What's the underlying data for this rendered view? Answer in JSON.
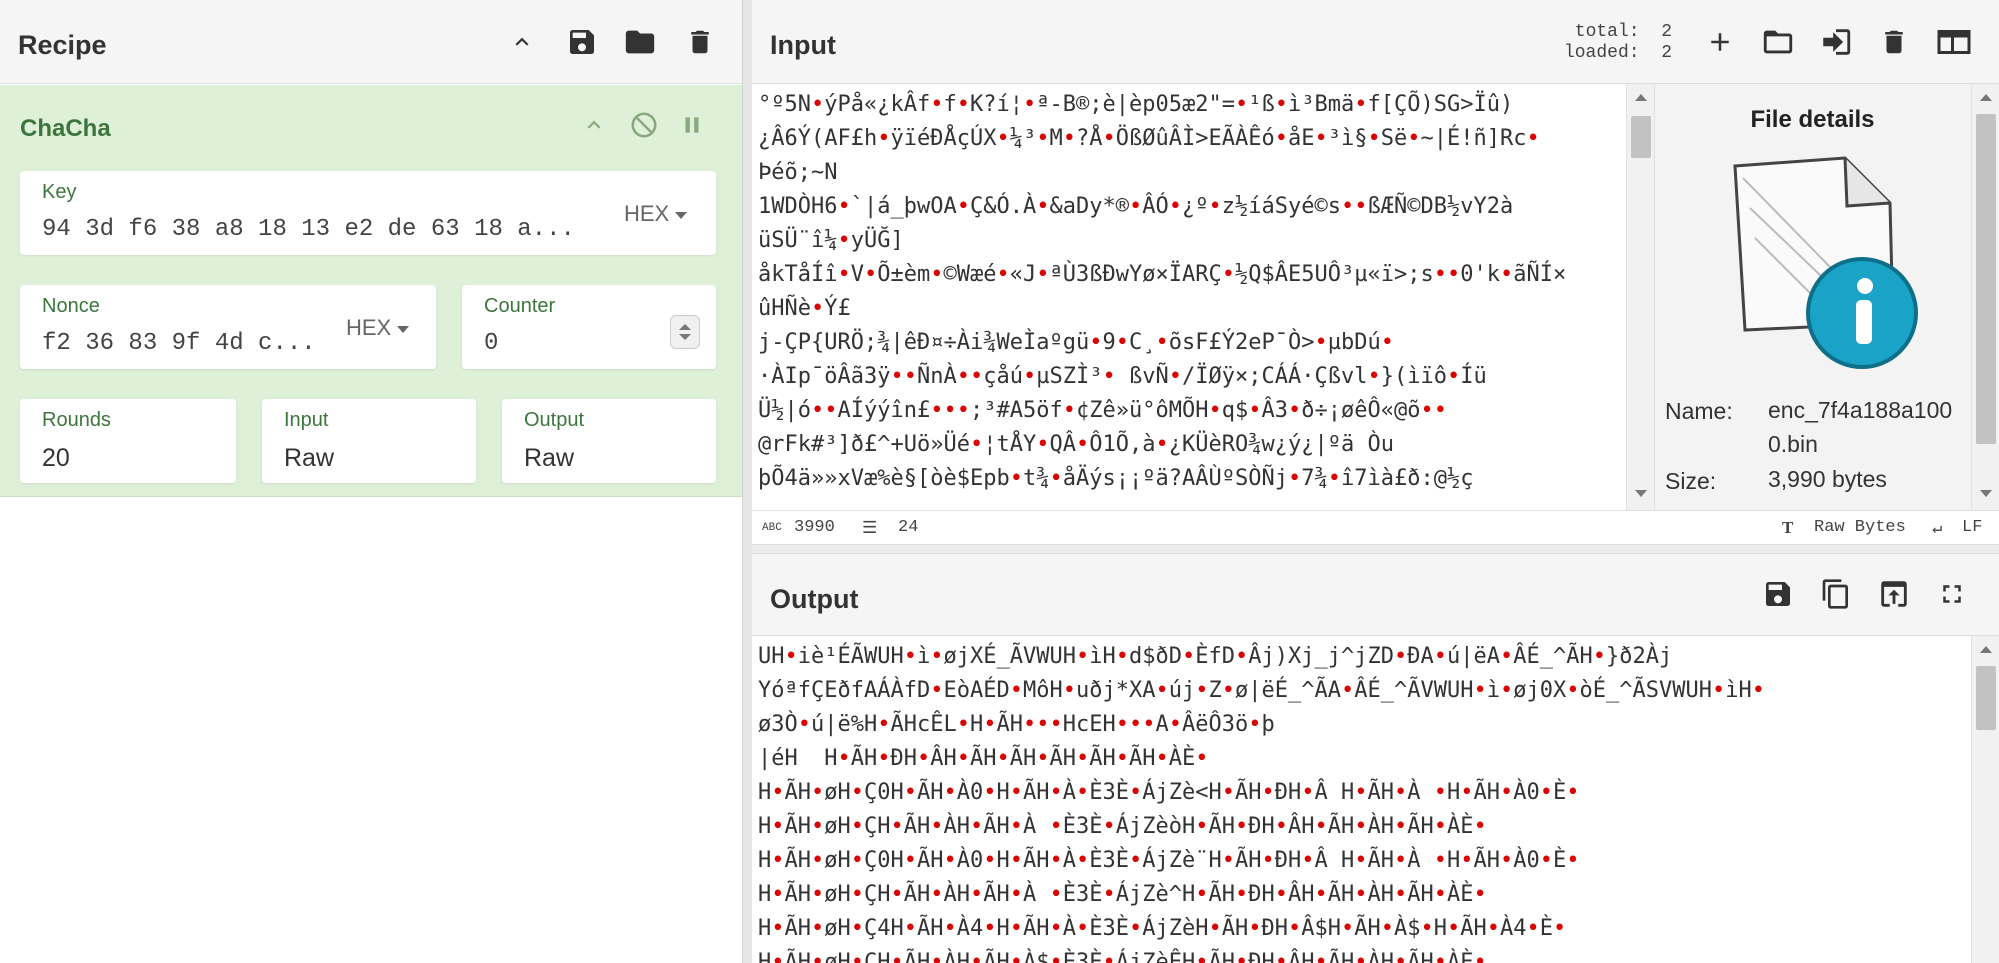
{
  "recipe": {
    "title": "Recipe"
  },
  "operation": {
    "name": "ChaCha",
    "key": {
      "label": "Key",
      "value": "94 3d f6 38 a8 18 13 e2 de 63 18 a...",
      "format": "HEX"
    },
    "nonce": {
      "label": "Nonce",
      "value": "f2 36 83 9f 4d c...",
      "format": "HEX"
    },
    "counter": {
      "label": "Counter",
      "value": "0"
    },
    "rounds": {
      "label": "Rounds",
      "value": "20"
    },
    "input_format": {
      "label": "Input",
      "value": "Raw"
    },
    "output_format": {
      "label": "Output",
      "value": "Raw"
    }
  },
  "input": {
    "title": "Input",
    "stats_total_label": "total:",
    "stats_total": "2",
    "stats_loaded_label": "loaded:",
    "stats_loaded": "2",
    "lines": [
      "°º5N•ýPå«¿kÂf•f•K?í¦•ª-B®;è|èp05æ2\"=•¹ß•ì³Bmä•f[ÇÕ)SG>Ïû)",
      "¿Â6Ý(AF£h•ÿïéÐÅçÚX•¼³•M•?Å•ÖßØûÂÌ>EÃÀÊó•åE•³ì§•Së•~|É!ñ]Rc•",
      "Þéõ;~N",
      "1WDÒH6•`|á_þwOA•Ç&Ó.À•&aDy*®•ÂÓ•¿º•z½íáSyé©s••ßÆÑ©DB½vY2à",
      "üSÜ¨î¼•yÜĞ]",
      "åkTåÍî•V•Õ±èm•©Wæé•«J•ªÙ3ßÐwYø×ÏARÇ•½Q$ÂE5UÔ³µ«ï>;s••0'k•ãÑÍ×",
      "ûHÑè•Ý£",
      "j-ÇP{URÖ;¾|êÐ¤÷Ài¾WeÌaºgü•9•C¸•õsF£Ý2eP¯Ò>•µbDú•",
      "·ÀIp¯öÂã3ÿ••ÑnÀ••çåú•µSZÌ³• ßvÑ•/ÏØÿ×;CÁÁ·Çßvl•}(ìïô•Íü",
      "Ü½|ó••AÍýýîn£•••;³#A5öf•¢Zê»ü°ôMÕH•q$•Â3•ð÷¡øêÔ«@õ••",
      "@rFk#³]ð£^+Uö»Üé•¦tÅY•QÂ•Ô1Õ,à•¿KÜèRO¾w¿ý¿|ºä Òu",
      "þÕ4ä»»xVæ%è§[òè$Epb•t¾•åÄýs¡¡ºä?AÂÙºSÒÑj•7¾•î7ìà£ð:@½ç"
    ],
    "status": {
      "chars": "3990",
      "lines": "24",
      "encoding": "Raw Bytes",
      "eol": "LF"
    }
  },
  "file_details": {
    "title": "File details",
    "name_label": "Name:",
    "name_value": "enc_7f4a188a100 0.bin",
    "size_label": "Size:",
    "size_value": "3,990 bytes"
  },
  "output": {
    "title": "Output",
    "lines": [
      "UH•iè¹ÉÃWUH•ì•øjXÉ_ÃVWUH•ìH•d$ðD•ÈfD•Âj)Xj_j^jZD•ÐA•ú|ëA•ÂÉ_^ÃH•}ð2Àj",
      "YóªfÇEðfAÁÀfD•EòAÉD•MôH•uðj*XA•új•Z•ø|ëÉ_^ÃA•ÂÉ_^ÃVWUH•ì•øj0X•òÉ_^ÃSVWUH•ìH•",
      "ø3Ò•ú|ë%H•ÃHcÊL•H•ÃH•••HcEH•••A•ÂëÔ3ö•þ",
      "|éH  H•ÃH•ÐH•ÂH•ÃH•ÃH•ÃH•ÃH•ÃH•ÀÈ•",
      "H•ÃH•øH•Ç0H•ÃH•À0•H•ÃH•À•È3È•ÁjZè<H•ÃH•ÐH•Â H•ÃH•À •H•ÃH•À0•È•",
      "H•ÃH•øH•ÇH•ÃH•ÀH•ÃH•À •È3È•ÁjZèòH•ÃH•ÐH•ÂH•ÃH•ÀH•ÃH•ÀÈ•",
      "H•ÃH•øH•Ç0H•ÃH•À0•H•ÃH•À•È3È•ÁjZè¨H•ÃH•ÐH•Â H•ÃH•À •H•ÃH•À0•È•",
      "H•ÃH•øH•ÇH•ÃH•ÀH•ÃH•À •È3È•ÁjZè^H•ÃH•ÐH•ÂH•ÃH•ÀH•ÃH•ÀÈ•",
      "H•ÃH•øH•Ç4H•ÃH•À4•H•ÃH•À•È3È•ÁjZèH•ÃH•ÐH•Â$H•ÃH•À$•H•ÃH•À4•È•",
      "H•ÃH•øH•ÇH•ÃH•ÀH•ÃH•À$•È3È•ÁjZèÊH•ÃH•ÐH•ÂH•ÃH•ÀH•ÃH•ÀÈ•"
    ]
  },
  "colors": {
    "accent_green": "#3c763d",
    "op_bg": "#dff0d8",
    "nonprint_dot": "#dd0000"
  },
  "icons": [
    "chevron-up-icon",
    "save-icon",
    "folder-icon",
    "trash-icon",
    "disable-icon",
    "pause-icon",
    "plus-icon",
    "import-icon",
    "layout-icon",
    "copy-icon",
    "replace-input-icon",
    "maximize-icon",
    "file-icon",
    "info-icon"
  ]
}
